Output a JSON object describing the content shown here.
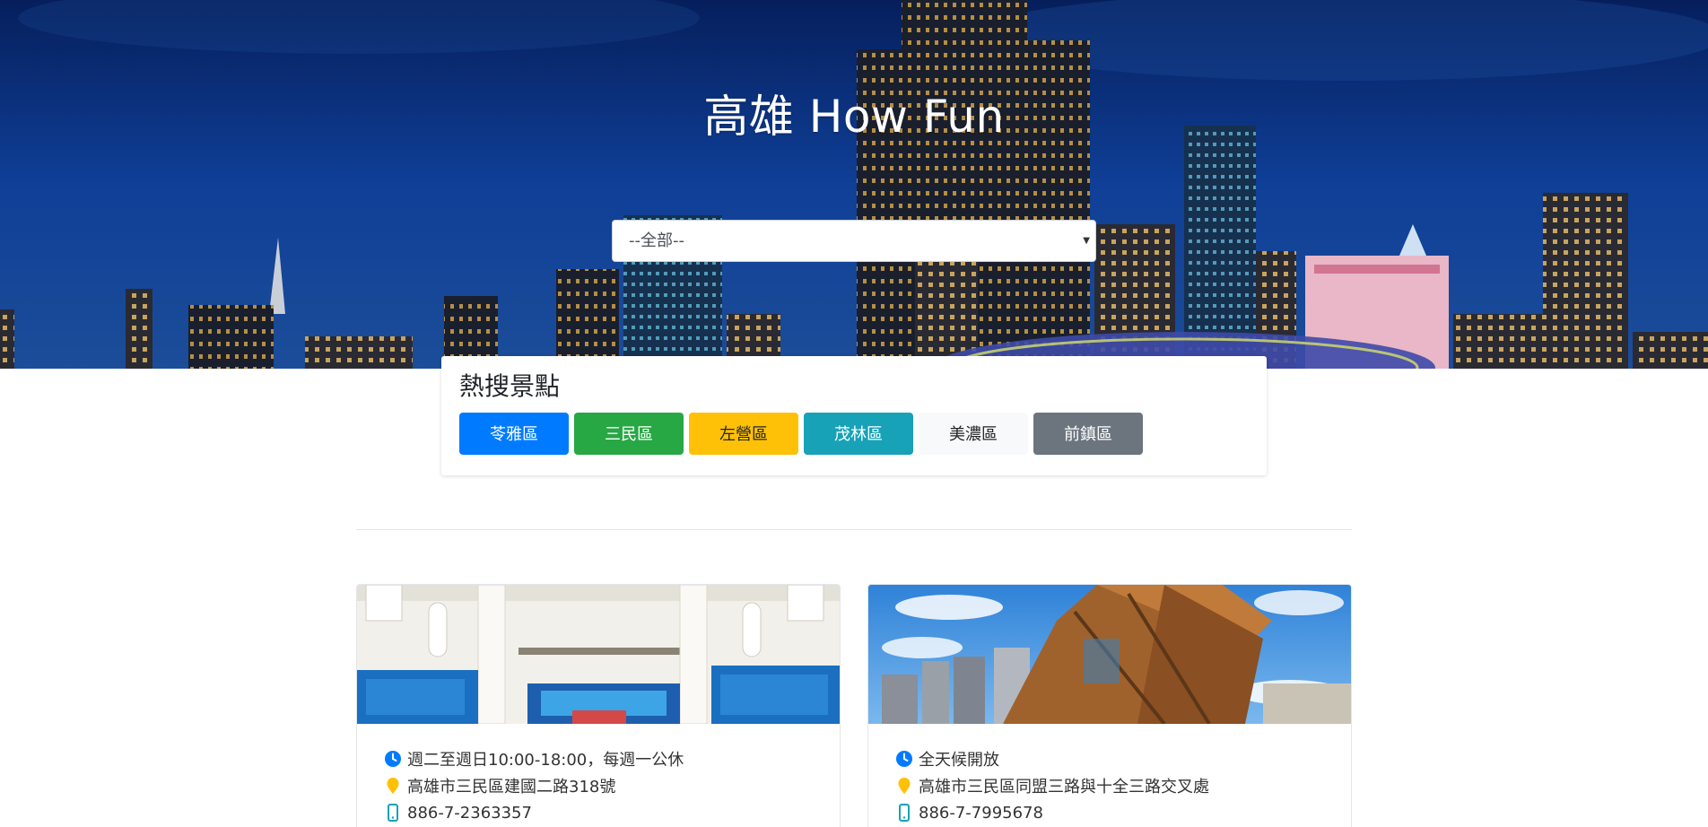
{
  "hero": {
    "title": "高雄 How Fun",
    "district_select": {
      "value": "--全部--"
    }
  },
  "hot_spots": {
    "title": "熱搜景點",
    "buttons": [
      {
        "label": "苓雅區",
        "bg": "#007bff",
        "fg": "#ffffff"
      },
      {
        "label": "三民區",
        "bg": "#28a745",
        "fg": "#ffffff"
      },
      {
        "label": "左營區",
        "bg": "#ffc107",
        "fg": "#212529"
      },
      {
        "label": "茂林區",
        "bg": "#17a2b8",
        "fg": "#ffffff"
      },
      {
        "label": "美濃區",
        "bg": "#f8f9fa",
        "fg": "#212529"
      },
      {
        "label": "前鎮區",
        "bg": "#6c757d",
        "fg": "#ffffff"
      }
    ]
  },
  "attractions": [
    {
      "hours": "週二至週日10:00-18:00，每週一公休",
      "address": "高雄市三民區建國二路318號",
      "phone": "886-7-2363357"
    },
    {
      "hours": "全天候開放",
      "address": "高雄市三民區同盟三路與十全三路交叉處",
      "phone": "886-7-7995678"
    }
  ],
  "icons": {
    "clock": "clock-icon",
    "location": "map-pin-icon",
    "phone": "mobile-phone-icon"
  },
  "colors": {
    "clock_icon": "#007bff",
    "pin_icon": "#ffc107",
    "phone_icon": "#17a2b8"
  }
}
